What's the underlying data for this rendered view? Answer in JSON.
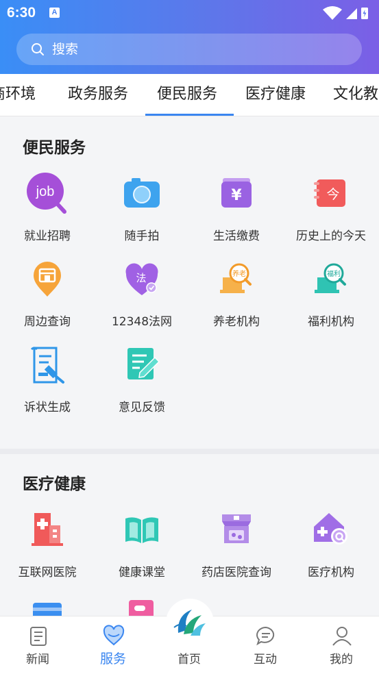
{
  "status": {
    "time": "6:30",
    "badge": "A"
  },
  "search": {
    "placeholder": "搜索"
  },
  "tabs": [
    {
      "label": "商环境"
    },
    {
      "label": "政务服务"
    },
    {
      "label": "便民服务"
    },
    {
      "label": "医疗健康"
    },
    {
      "label": "文化教"
    }
  ],
  "sections": {
    "convenience": {
      "title": "便民服务",
      "items": [
        {
          "label": "就业招聘",
          "icon": "job-icon",
          "icon_text": "job"
        },
        {
          "label": "随手拍",
          "icon": "camera-icon"
        },
        {
          "label": "生活缴费",
          "icon": "yen-wallet-icon",
          "icon_text": "¥"
        },
        {
          "label": "历史上的今天",
          "icon": "today-calendar-icon",
          "icon_text": "今"
        },
        {
          "label": "周边查询",
          "icon": "nearby-pin-icon"
        },
        {
          "label": "12348法网",
          "icon": "law-heart-icon",
          "icon_text": "法"
        },
        {
          "label": "养老机构",
          "icon": "elderly-care-icon",
          "icon_text": "养老"
        },
        {
          "label": "福利机构",
          "icon": "welfare-icon",
          "icon_text": "福利"
        },
        {
          "label": "诉状生成",
          "icon": "lawsuit-document-icon"
        },
        {
          "label": "意见反馈",
          "icon": "feedback-edit-icon"
        }
      ]
    },
    "medical": {
      "title": "医疗健康",
      "items": [
        {
          "label": "互联网医院",
          "icon": "hospital-icon"
        },
        {
          "label": "健康课堂",
          "icon": "book-icon"
        },
        {
          "label": "药店医院查询",
          "icon": "pharmacy-store-icon"
        },
        {
          "label": "医疗机构",
          "icon": "medical-search-icon"
        }
      ]
    }
  },
  "bottom_nav": [
    {
      "label": "新闻",
      "icon": "news-icon"
    },
    {
      "label": "服务",
      "icon": "heart-service-icon"
    },
    {
      "label": "首页",
      "icon": "home-logo-icon"
    },
    {
      "label": "互动",
      "icon": "chat-icon"
    },
    {
      "label": "我的",
      "icon": "user-icon"
    }
  ],
  "colors": {
    "accent": "#3a86f0",
    "header_start": "#3a8ef6",
    "header_end": "#7b5fe6"
  }
}
